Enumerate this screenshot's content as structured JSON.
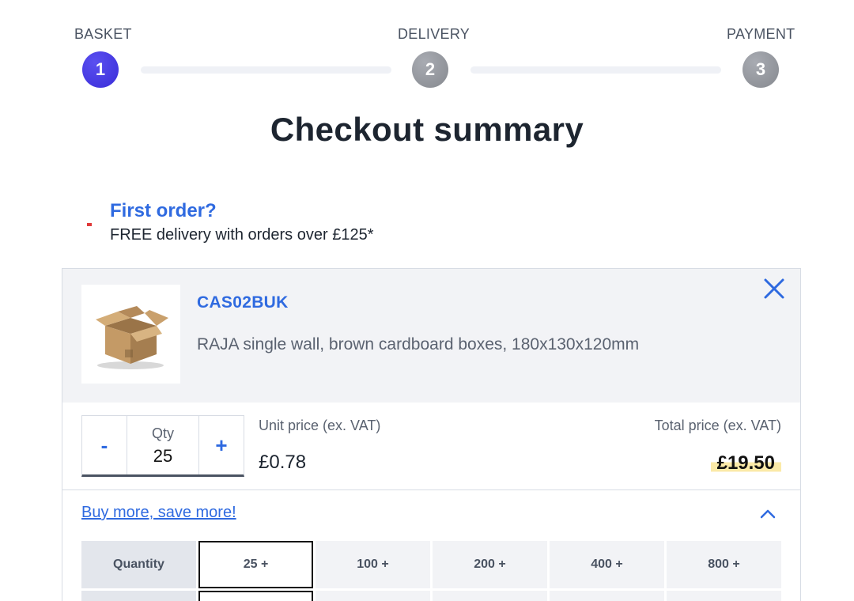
{
  "stepper": {
    "steps": [
      {
        "label": "BASKET",
        "number": "1",
        "state": "active"
      },
      {
        "label": "DELIVERY",
        "number": "2",
        "state": "inactive"
      },
      {
        "label": "PAYMENT",
        "number": "3",
        "state": "inactive"
      }
    ]
  },
  "page_title": "Checkout summary",
  "promo": {
    "title": "First order?",
    "text": "FREE delivery with orders over £125*"
  },
  "item": {
    "sku": "CAS02BUK",
    "description": "RAJA single wall, brown cardboard boxes, 180x130x120mm",
    "image_icon": "cardboard-box-icon",
    "close_icon": "close-icon",
    "qty": {
      "minus_label": "-",
      "label": "Qty",
      "value": "25",
      "plus_label": "+"
    },
    "unit_price_label": "Unit price (ex. VAT)",
    "unit_price": "£0.78",
    "total_price_label": "Total price (ex. VAT)",
    "total_price": "£19.50"
  },
  "buy_more": {
    "link_label": "Buy more, save more!",
    "expanded": true,
    "table": {
      "header_label": "Quantity",
      "tiers": [
        "25 +",
        "100 +",
        "200 +",
        "400 +",
        "800 +"
      ],
      "selected_tier": "25 +"
    }
  },
  "colors": {
    "accent": "#2f6ae0",
    "active_step": "#3a2dd8",
    "inactive_step": "#86898f",
    "highlight": "#fbeaa8"
  }
}
